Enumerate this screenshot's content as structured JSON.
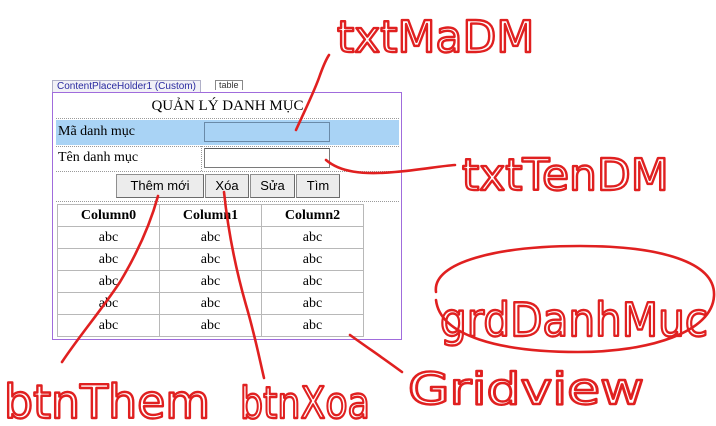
{
  "designer": {
    "placeholder_label": "ContentPlaceHolder1 (Custom)",
    "table_tag": "table"
  },
  "form": {
    "title": "QUẢN LÝ DANH MỤC",
    "ma_label": "Mã danh mục",
    "ten_label": "Tên danh mục",
    "txt_ma_value": "",
    "txt_ten_value": ""
  },
  "buttons": {
    "them": "Thêm mới",
    "xoa": "Xóa",
    "sua": "Sửa",
    "tim": "Tìm"
  },
  "grid": {
    "headers": [
      "Column0",
      "Column1",
      "Column2"
    ],
    "rows": [
      [
        "abc",
        "abc",
        "abc"
      ],
      [
        "abc",
        "abc",
        "abc"
      ],
      [
        "abc",
        "abc",
        "abc"
      ],
      [
        "abc",
        "abc",
        "abc"
      ],
      [
        "abc",
        "abc",
        "abc"
      ]
    ]
  },
  "annotations": {
    "txt_ma": "txtMaDM",
    "txt_ten": "txtTenDM",
    "grd": "grdDanhMuc",
    "gridview": "Gridview",
    "btn_them": "btnThem",
    "btn_xoa": "btnXoa",
    "ink_color": "#e02020"
  }
}
